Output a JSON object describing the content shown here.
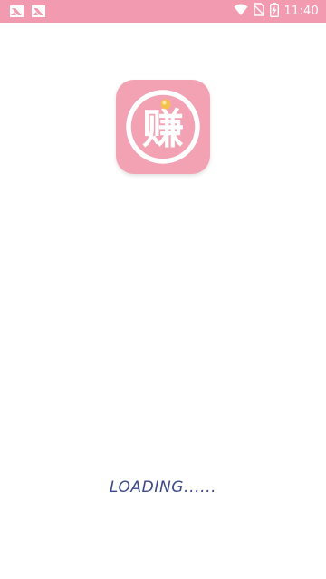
{
  "status_bar": {
    "time": "11:40",
    "background_color": "#f29bb0",
    "icons": [
      "image-notification-icon",
      "image-notification-icon",
      "wifi-icon",
      "no-sim-icon",
      "battery-charging-icon"
    ]
  },
  "splash": {
    "logo_char": "赚",
    "logo_background": "#f2a2b3",
    "loading_label": "LOADING......",
    "loading_color": "#3b4a86"
  }
}
